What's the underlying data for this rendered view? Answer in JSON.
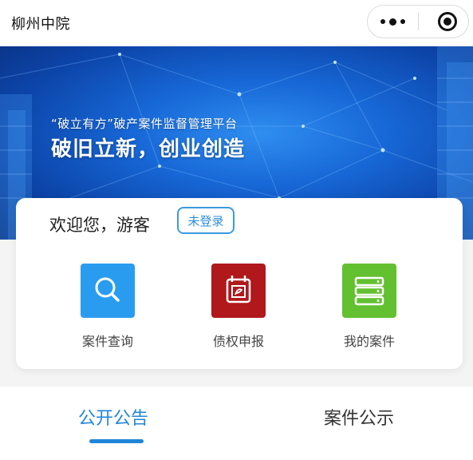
{
  "app": {
    "title": "柳州中院"
  },
  "capsule": {
    "more_icon": "more-dots-icon",
    "close_icon": "target-close-icon"
  },
  "banner": {
    "subtitle": "“破立有方”破产案件监督管理平台",
    "headline": "破旧立新，创业创造"
  },
  "welcome": {
    "greeting": "欢迎您，游客",
    "login_status": "未登录"
  },
  "functions": [
    {
      "label": "案件查询",
      "icon": "search-icon",
      "color": "#2a9cf0"
    },
    {
      "label": "债权申报",
      "icon": "calendar-edit-icon",
      "color": "#b0181c"
    },
    {
      "label": "我的案件",
      "icon": "server-list-icon",
      "color": "#63c030"
    }
  ],
  "tabs": [
    {
      "label": "公开公告",
      "active": true
    },
    {
      "label": "案件公示",
      "active": false
    }
  ],
  "colors": {
    "accent": "#1f86d8",
    "banner": "#1767d6"
  }
}
